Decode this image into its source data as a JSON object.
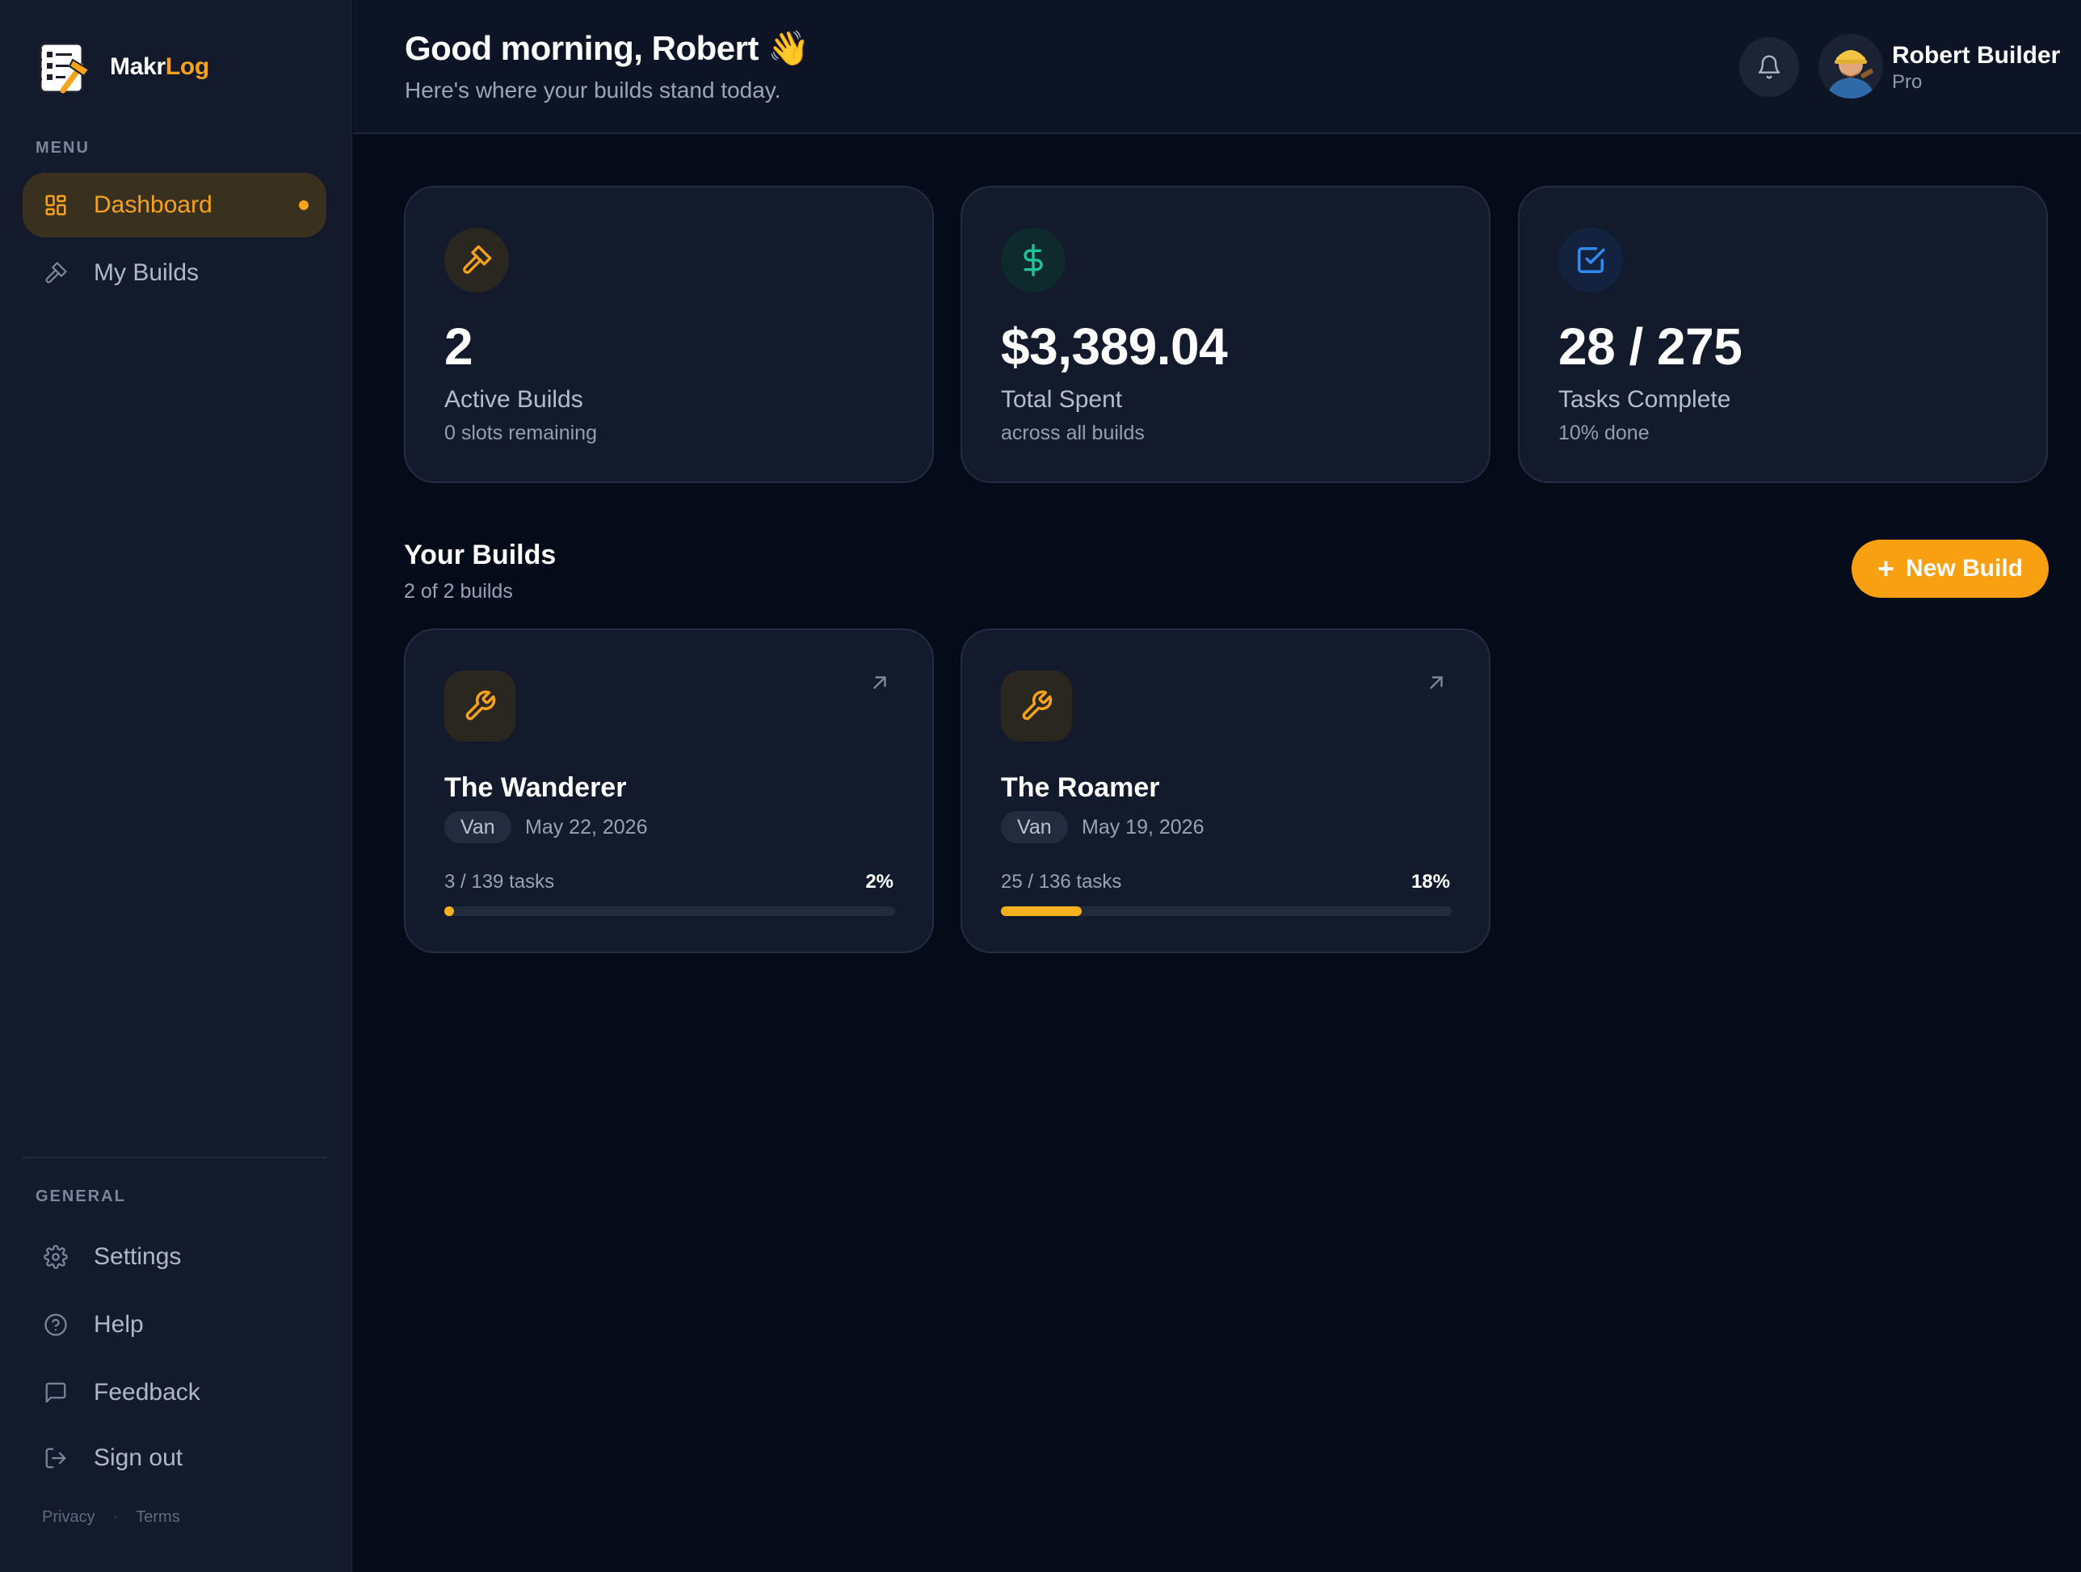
{
  "brand": {
    "name_part1": "Makr",
    "name_part2": "Log"
  },
  "sidebar": {
    "menu_label": "MENU",
    "menu_items": [
      {
        "label": "Dashboard",
        "icon": "dashboard-grid-icon",
        "active": true
      },
      {
        "label": "My Builds",
        "icon": "hammer-icon",
        "active": false
      }
    ],
    "general_label": "GENERAL",
    "general_items": [
      {
        "label": "Settings",
        "icon": "gear-icon"
      },
      {
        "label": "Help",
        "icon": "help-circle-icon"
      },
      {
        "label": "Feedback",
        "icon": "message-square-icon"
      },
      {
        "label": "Sign out",
        "icon": "sign-out-icon"
      }
    ],
    "footer": {
      "privacy": "Privacy",
      "separator": "·",
      "terms": "Terms"
    }
  },
  "header": {
    "greeting": "Good morning, Robert 👋",
    "subtitle": "Here's where your builds stand today.",
    "user": {
      "name": "Robert Builder",
      "plan": "Pro"
    }
  },
  "stats": [
    {
      "value": "2",
      "label": "Active Builds",
      "sub": "0 slots remaining",
      "icon": "hammer-icon",
      "color": "#f7a21b",
      "bg": "#2a2620"
    },
    {
      "value": "$3,389.04",
      "label": "Total Spent",
      "sub": "across all builds",
      "icon": "dollar-icon",
      "color": "#1fc59a",
      "bg": "#0f2a2c"
    },
    {
      "value": "28 / 275",
      "label": "Tasks Complete",
      "sub": "10% done",
      "icon": "check-square-icon",
      "color": "#2f8bf0",
      "bg": "#13233f"
    }
  ],
  "builds_section": {
    "title": "Your Builds",
    "count": "2 of 2 builds",
    "new_button": "New Build"
  },
  "builds": [
    {
      "name": "The Wanderer",
      "tag": "Van",
      "date": "May 22, 2026",
      "tasks": "3 / 139 tasks",
      "percent_label": "2%",
      "progress": 0.02
    },
    {
      "name": "The Roamer",
      "tag": "Van",
      "date": "May 19, 2026",
      "tasks": "25 / 136 tasks",
      "percent_label": "18%",
      "progress": 0.18
    }
  ],
  "colors": {
    "accent": "#f7a21b",
    "background": "#050b18",
    "sidebar": "#121a2c",
    "card": "#121a2b"
  }
}
